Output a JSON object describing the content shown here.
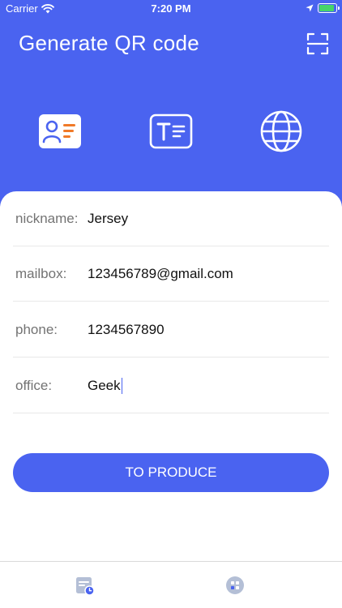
{
  "status_bar": {
    "carrier": "Carrier",
    "time": "7:20 PM",
    "battery_color": "#46d46a"
  },
  "header": {
    "title": "Generate QR code",
    "background_color": "#4a63f0",
    "scan_icon": "scan-icon",
    "type_icons": [
      "contact-card-icon",
      "text-icon",
      "globe-icon"
    ]
  },
  "form": {
    "fields": [
      {
        "label": "nickname:",
        "value": "Jersey"
      },
      {
        "label": "mailbox:",
        "value": "123456789@gmail.com"
      },
      {
        "label": "phone:",
        "value": "1234567890"
      },
      {
        "label": "office:",
        "value": "Geek"
      }
    ],
    "submit_label": "TO PRODUCE"
  },
  "tab_bar": {
    "tabs": [
      "history-icon",
      "grid-icon"
    ]
  }
}
